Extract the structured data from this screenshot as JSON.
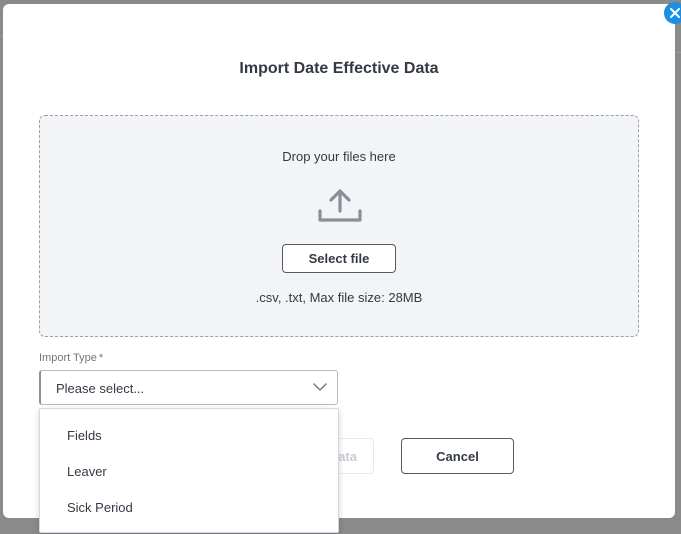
{
  "modal": {
    "title": "Import Date Effective Data",
    "close_icon": "close-icon"
  },
  "dropzone": {
    "prompt": "Drop your files here",
    "icon": "upload-icon",
    "select_button": "Select file",
    "hint": ".csv, .txt, Max file size: 28MB"
  },
  "import_type": {
    "label": "Import Type",
    "required_marker": "*",
    "placeholder": "Please select...",
    "options": [
      "Fields",
      "Leaver",
      "Sick Period"
    ]
  },
  "actions": {
    "primary_partial": "ata",
    "cancel": "Cancel"
  },
  "colors": {
    "accent": "#1a8fe3",
    "text": "#333a44",
    "dropzone_bg": "#f3f4f6",
    "overlay": "#8a8a8a"
  }
}
